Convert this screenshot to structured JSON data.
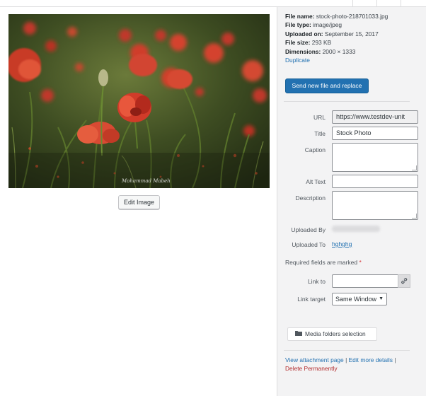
{
  "header": {},
  "image": {
    "alt": "Red poppy flowers in a green meadow"
  },
  "left": {
    "edit_image_label": "Edit Image"
  },
  "meta": {
    "file_name_label": "File name:",
    "file_name": "stock-photo-218701033.jpg",
    "file_type_label": "File type:",
    "file_type": "image/jpeg",
    "uploaded_on_label": "Uploaded on:",
    "uploaded_on": "September 15, 2017",
    "file_size_label": "File size:",
    "file_size": "293 KB",
    "dimensions_label": "Dimensions:",
    "dimensions": "2000 × 1333",
    "duplicate_link": "Duplicate"
  },
  "replace_button": "Send new file and replace",
  "fields": {
    "url_label": "URL",
    "url_value": "https://www.testdev-unit",
    "title_label": "Title",
    "title_value": "Stock Photo",
    "caption_label": "Caption",
    "caption_value": "",
    "alt_label": "Alt Text",
    "alt_value": "",
    "description_label": "Description",
    "description_value": "",
    "uploaded_by_label": "Uploaded By",
    "uploaded_to_label": "Uploaded To",
    "uploaded_to_value": "hghghg",
    "required_note": "Required fields are marked",
    "required_star": "*",
    "link_to_label": "Link to",
    "link_to_value": "",
    "link_target_label": "Link target",
    "link_target_value": "Same Window"
  },
  "media_folders_button": "Media folders selection",
  "actions": {
    "view_attachment": "View attachment page",
    "edit_more": "Edit more details",
    "delete": "Delete Permanently",
    "separator": "|"
  },
  "icons": {
    "link": "link-icon",
    "folder": "folder-icon",
    "dropdown": "chevron-down-icon"
  },
  "colors": {
    "primary_button": "#2271b1",
    "link": "#2271b1",
    "delete": "#b32d2e",
    "sidebar_bg": "#f3f3f4"
  }
}
